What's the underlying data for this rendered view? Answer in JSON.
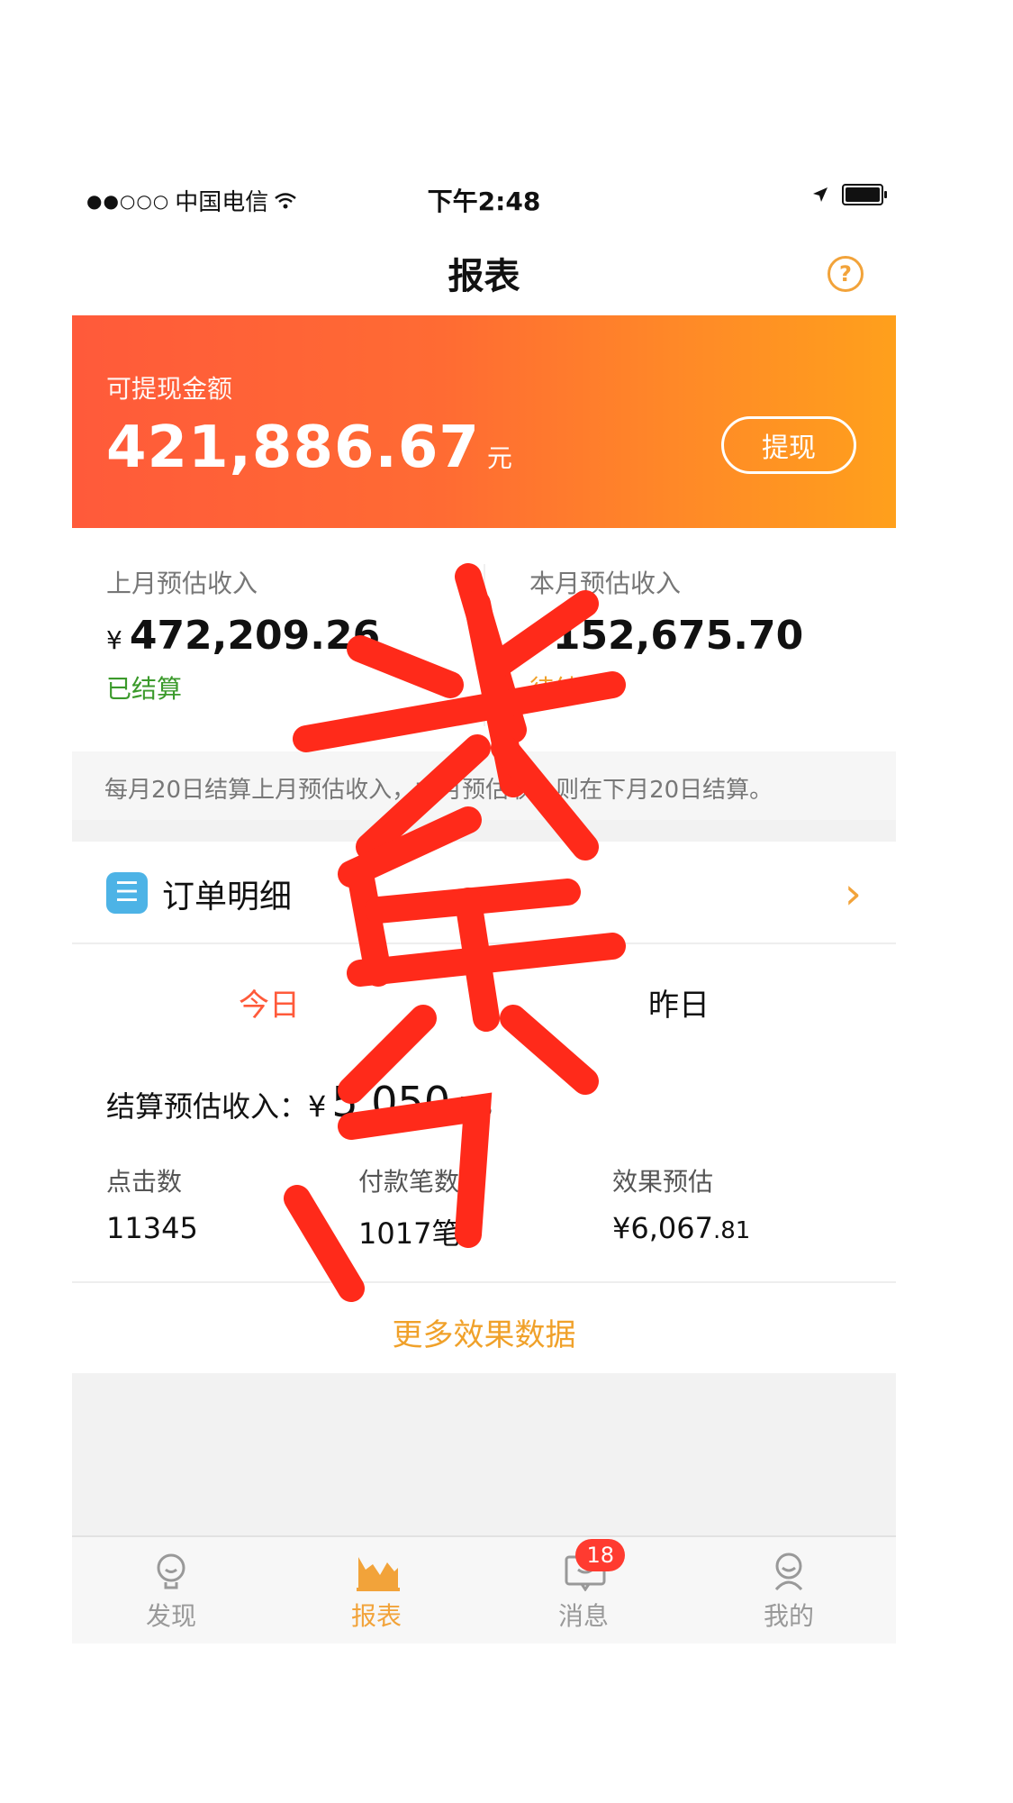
{
  "status_bar": {
    "signal": "●●○○○",
    "carrier": "中国电信",
    "time": "下午2:48"
  },
  "nav": {
    "title": "报表"
  },
  "balance": {
    "label": "可提现金额",
    "amount": "421,886.67",
    "unit": "元",
    "withdraw_label": "提现"
  },
  "income": {
    "currency": "¥",
    "last_month": {
      "label": "上月预估收入",
      "value": "472,209.26",
      "status": "已结算"
    },
    "this_month": {
      "label": "本月预估收入",
      "value": "152,675.70",
      "status": "待结算"
    }
  },
  "note": "每月20日结算上月预估收入，本月预估收入则在下月20日结算。",
  "order_detail": {
    "label": "订单明细"
  },
  "tabs": {
    "today": "今日",
    "yesterday": "昨日"
  },
  "stats": {
    "settle_label": "结算预估收入",
    "currency": "¥",
    "settle_major": "5,050",
    "settle_minor": ".73",
    "clicks": {
      "label": "点击数",
      "value": "11345"
    },
    "payments": {
      "label": "付款笔数",
      "value": "1017笔"
    },
    "effect": {
      "label": "效果预估",
      "value_major": "¥6,067",
      "value_minor": ".81"
    }
  },
  "more_link": "更多效果数据",
  "tabbar": {
    "items": [
      {
        "label": "发现"
      },
      {
        "label": "报表"
      },
      {
        "label": "消息",
        "badge": "18"
      },
      {
        "label": "我的"
      }
    ]
  },
  "watermark": "小兵米",
  "colors": {
    "accent": "#f2a33a",
    "banner_start": "#ff5a3a",
    "banner_end": "#ffa01c",
    "stamp": "#ff2a1a"
  }
}
